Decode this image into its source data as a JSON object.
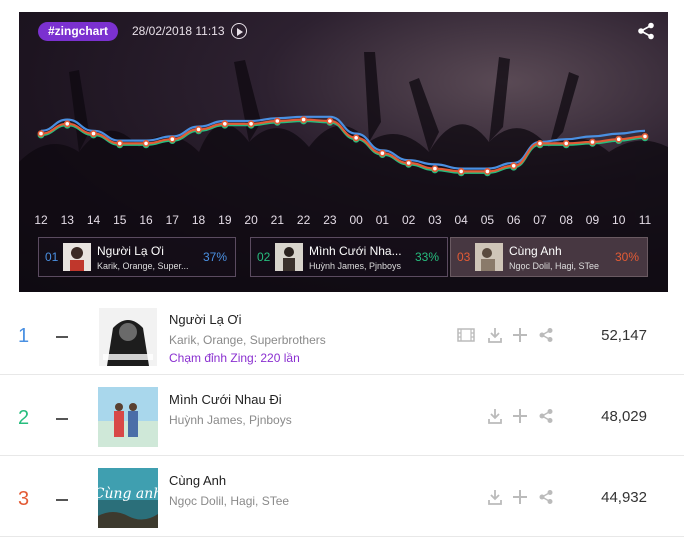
{
  "header": {
    "tag": "#zingchart",
    "datetime": "28/02/2018 11:13"
  },
  "colors": {
    "rank1": "#4a90e2",
    "rank2": "#27bd7e",
    "rank3": "#e35b35",
    "accent": "#7b31d0",
    "peak_text": "#8a2fd0"
  },
  "chart_data": {
    "type": "line",
    "x": [
      "12",
      "13",
      "14",
      "15",
      "16",
      "17",
      "18",
      "19",
      "20",
      "21",
      "22",
      "23",
      "00",
      "01",
      "02",
      "03",
      "04",
      "05",
      "06",
      "07",
      "08",
      "09",
      "10",
      "11"
    ],
    "ylim": [
      0,
      100
    ],
    "series": [
      {
        "name": "Người Lạ Ơi",
        "color": "#4a90e2",
        "values": [
          58,
          66,
          58,
          51,
          51,
          54,
          61,
          65,
          65,
          67,
          68,
          68,
          56,
          44,
          37,
          34,
          31,
          31,
          35,
          50,
          52,
          54,
          56,
          58
        ]
      },
      {
        "name": "Mình Cưới Nhau Đi",
        "color": "#27bd7e",
        "values": [
          55,
          62,
          55,
          48,
          48,
          51,
          58,
          62,
          62,
          64,
          65,
          64,
          52,
          41,
          34,
          30,
          28,
          28,
          32,
          48,
          48,
          49,
          51,
          53
        ]
      },
      {
        "name": "Cùng Anh",
        "color": "#e35b35",
        "values": [
          56,
          63,
          56,
          49,
          49,
          52,
          59,
          63,
          63,
          65,
          66,
          65,
          53,
          42,
          35,
          31,
          29,
          29,
          33,
          49,
          49,
          50,
          52,
          54
        ]
      }
    ]
  },
  "cards": [
    {
      "num": "01",
      "title": "Người Lạ Ơi",
      "artists": "Karik, Orange, Super...",
      "pct": "37%"
    },
    {
      "num": "02",
      "title": "Mình Cưới Nha...",
      "artists": "Huỳnh James, Pjnboys",
      "pct": "33%"
    },
    {
      "num": "03",
      "title": "Cùng Anh",
      "artists": "Ngọc Dolil, Hagi, STee",
      "pct": "30%"
    }
  ],
  "rows": [
    {
      "rank": "1",
      "title": "Người Lạ Ơi",
      "artists": "Karik, Orange, Superbrothers",
      "peak": "Chạm đỉnh Zing: 220 lần",
      "count": "52,147"
    },
    {
      "rank": "2",
      "title": "Mình Cưới Nhau Đi",
      "artists": "Huỳnh James, Pjnboys",
      "count": "48,029"
    },
    {
      "rank": "3",
      "title": "Cùng Anh",
      "artists": "Ngọc Dolil, Hagi, STee",
      "count": "44,932",
      "cover_text": "Cùng anh"
    }
  ]
}
